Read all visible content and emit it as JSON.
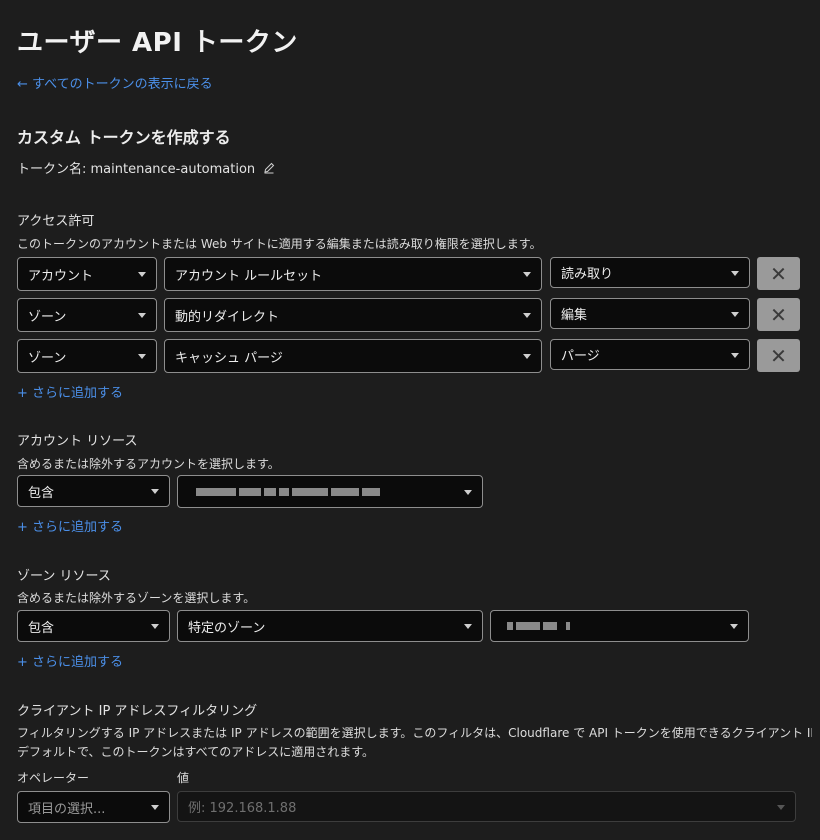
{
  "page": {
    "title": "ユーザー API トークン",
    "back_link": "← すべてのトークンの表示に戻る"
  },
  "token": {
    "heading": "カスタム トークンを作成する",
    "name_label": "トークン名: maintenance-automation",
    "edit_icon": "pencil-icon"
  },
  "permissions": {
    "heading": "アクセス許可",
    "description": "このトークンのアカウントまたは Web サイトに適用する編集または読み取り権限を選択します。",
    "rows": [
      {
        "scope": "アカウント",
        "resource": "アカウント ルールセット",
        "access": "読み取り"
      },
      {
        "scope": "ゾーン",
        "resource": "動的リダイレクト",
        "access": "編集"
      },
      {
        "scope": "ゾーン",
        "resource": "キャッシュ パージ",
        "access": "パージ"
      }
    ],
    "add_more": "+ さらに追加する",
    "remove_icon": "close-icon"
  },
  "account_resources": {
    "heading": "アカウント リソース",
    "description": "含めるまたは除外するアカウントを選択します。",
    "mode": "包含",
    "add_more": "+ さらに追加する"
  },
  "zone_resources": {
    "heading": "ゾーン リソース",
    "description": "含めるまたは除外するゾーンを選択します。",
    "mode": "包含",
    "zone_type": "特定のゾーン",
    "add_more": "+ さらに追加する"
  },
  "ip_filter": {
    "heading": "クライアント IP アドレスフィルタリング",
    "description1": "フィルタリングする IP アドレスまたは IP アドレスの範囲を選択します。このフィルタは、Cloudflare で API トークンを使用できるクライアント IP アドレスを制限します。",
    "description2": "デフォルトで、このトークンはすべてのアドレスに適用されます。",
    "operator_label": "オペレーター",
    "value_label": "値",
    "operator_placeholder": "項目の選択...",
    "value_placeholder": "例: 192.168.1.88"
  },
  "colors": {
    "background": "#1d1d1d",
    "link": "#4b8fe8",
    "input_bg": "#0b0b0b",
    "remove_button": "#9a9a9a"
  }
}
